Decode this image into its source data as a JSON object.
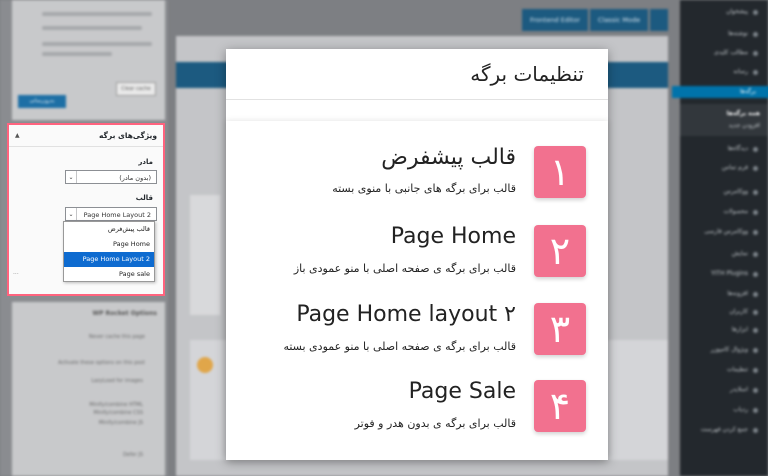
{
  "colors": {
    "accent": "#f2718f",
    "highlight_border": "#ff637e",
    "wp_blue": "#0073aa",
    "option_selected": "#0e6bd0"
  },
  "popup": {
    "title": "تنظیمات برگه",
    "items": [
      {
        "number": "۱",
        "title": "قالب پیشفرض",
        "description": "قالب برای برگه های جانبی با منوی بسته"
      },
      {
        "number": "۲",
        "title": "Page Home",
        "description": "قالب برای برگه ی صفحه اصلی با منو عمودی باز"
      },
      {
        "number": "۳",
        "title": "Page Home layout ۲",
        "description": "قالب برای برگه ی صفحه اصلی با منو عمودی بسته"
      },
      {
        "number": "۴",
        "title": "Page Sale",
        "description": "قالب برای برگه ی بدون هدر و فوتر"
      }
    ]
  },
  "attributes_box": {
    "title": "ویژگی‌های برگه",
    "parent_label": "مادر",
    "parent_value": "(بدون مادر)",
    "template_label": "قالب",
    "template_value": "Page Home Layout 2",
    "template_options": [
      "قالب پیش‌فرض",
      "Page Home",
      "Page Home Layout 2",
      "Page sale"
    ],
    "selected_index": 2
  },
  "background": {
    "top_buttons": [
      "Frontend Editor",
      "Classic Mode"
    ],
    "clear_cache": "Clear cache",
    "cache_options_title": "WP Rocket Options",
    "publish_button": "به‌روزرسانی",
    "never_cache": "Never cache this page",
    "activate_options": "Activate these options on this post",
    "option_labels": [
      "LazyLoad for images",
      "Minify/combine HTML",
      "Minify/combine CSS",
      "Minify/combine JS",
      "Defer JS"
    ],
    "admin_menu": [
      "پیشخوان",
      "نوشته‌ها",
      "مطالب کلیدی",
      "رسانه",
      "برگه‌ها",
      "همه برگه‌ها",
      "افزودن جدید",
      "دیدگاه‌ها",
      "فرم تماس",
      "ووکامرس",
      "محصولات",
      "ووکامرس فارسی",
      "نمایش",
      "YITH Plugins",
      "افزونه‌ها",
      "کاربران",
      "ابزارها",
      "ویژوال کامپوزر",
      "تنظیمات",
      "اسلایدر",
      "ردیاب",
      "جمع کردن فهرست"
    ]
  }
}
